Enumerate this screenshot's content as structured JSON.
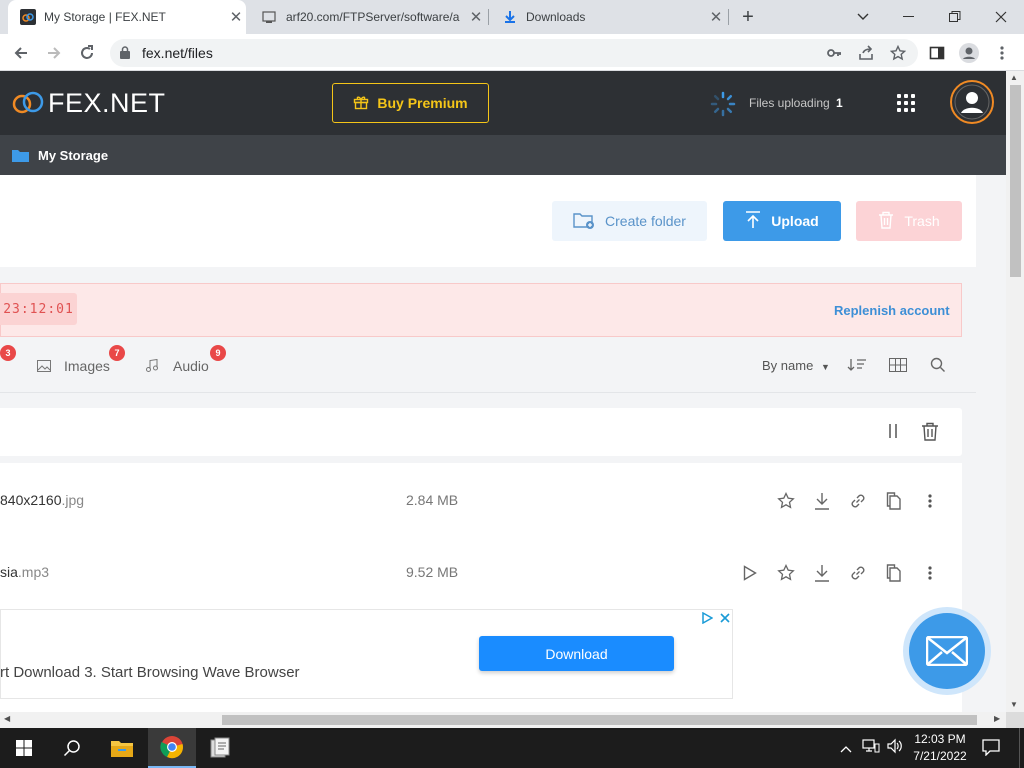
{
  "browser": {
    "tabs": [
      {
        "title": "My Storage | FEX.NET",
        "active": true
      },
      {
        "title": "arf20.com/FTPServer/software/a",
        "active": false
      },
      {
        "title": "Downloads",
        "active": false
      }
    ],
    "url": "fex.net/files"
  },
  "header": {
    "logo": "FEX.NET",
    "premium_label": "Buy Premium",
    "uploading_label": "Files uploading",
    "uploading_count": "1"
  },
  "breadcrumb": {
    "label": "My Storage"
  },
  "actions": {
    "create_folder": "Create folder",
    "upload": "Upload",
    "trash": "Trash"
  },
  "notice": {
    "timer": "23:12:01",
    "replenish": "Replenish account"
  },
  "filters": {
    "first_badge": "3",
    "images_label": "Images",
    "images_badge": "7",
    "audio_label": "Audio",
    "audio_badge": "9",
    "sort_label": "By name"
  },
  "files": [
    {
      "name": "840x2160",
      "ext": ".jpg",
      "size": "2.84 MB",
      "type": "image"
    },
    {
      "name": "sia",
      "ext": ".mp3",
      "size": "9.52 MB",
      "type": "audio"
    }
  ],
  "ad": {
    "text": "rt Download 3. Start Browsing Wave Browser",
    "button": "Download"
  },
  "taskbar": {
    "time": "12:03 PM",
    "date": "7/21/2022"
  },
  "colors": {
    "accent_blue": "#3d9ae8",
    "premium_yellow": "#f5c518",
    "danger_red": "#e94848"
  }
}
